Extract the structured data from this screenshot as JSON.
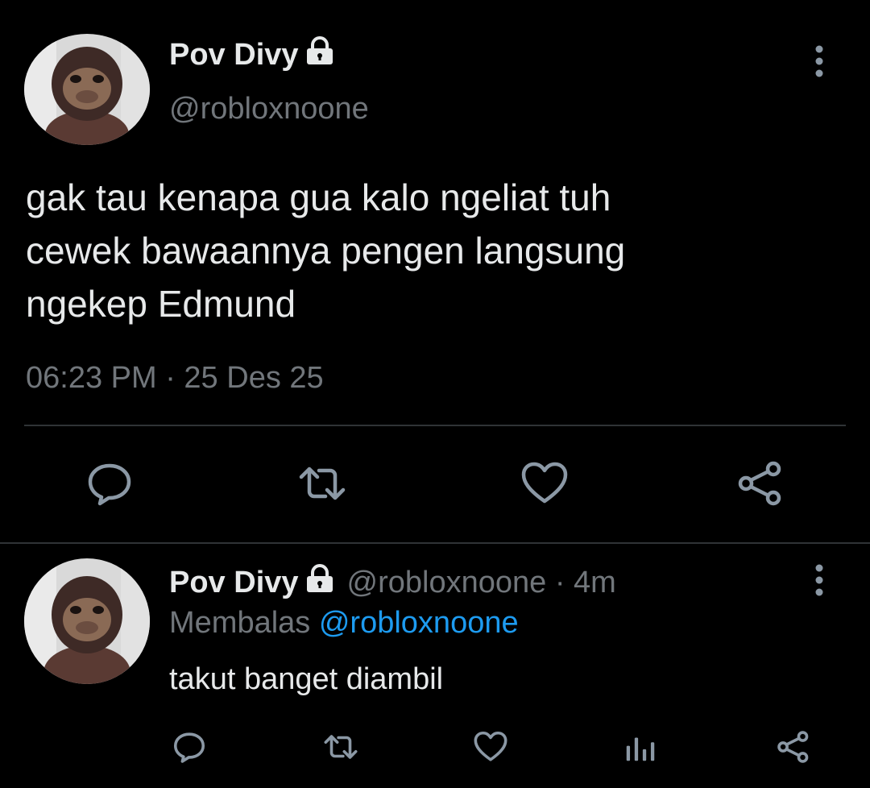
{
  "main_tweet": {
    "display_name": "Pov Divy",
    "handle": "@robloxnoone",
    "text": "gak tau kenapa gua kalo ngeliat tuh\ncewek bawaannya pengen langsung\nngekep Edmund",
    "timestamp": "06:23 PM · 25 Des 25",
    "avatar_icon": "monkey-avatar-icon",
    "actions": [
      "reply-icon",
      "retweet-icon",
      "like-icon",
      "share-icon"
    ]
  },
  "reply_tweet": {
    "display_name": "Pov Divy",
    "handle_time": "@robloxnoone · 4m",
    "replying_prefix": "Membalas",
    "replying_to": "@robloxnoone",
    "text": "takut banget diambil",
    "avatar_icon": "monkey-avatar-icon",
    "actions": [
      "reply-icon",
      "retweet-icon",
      "like-icon",
      "analytics-icon",
      "share-icon"
    ]
  },
  "colors": {
    "background": "#000000",
    "primary_text": "#e7e9ea",
    "secondary_text": "#71767b",
    "mention": "#1d9bf0",
    "icon": "#8b98a5",
    "divider": "#2f3336"
  }
}
